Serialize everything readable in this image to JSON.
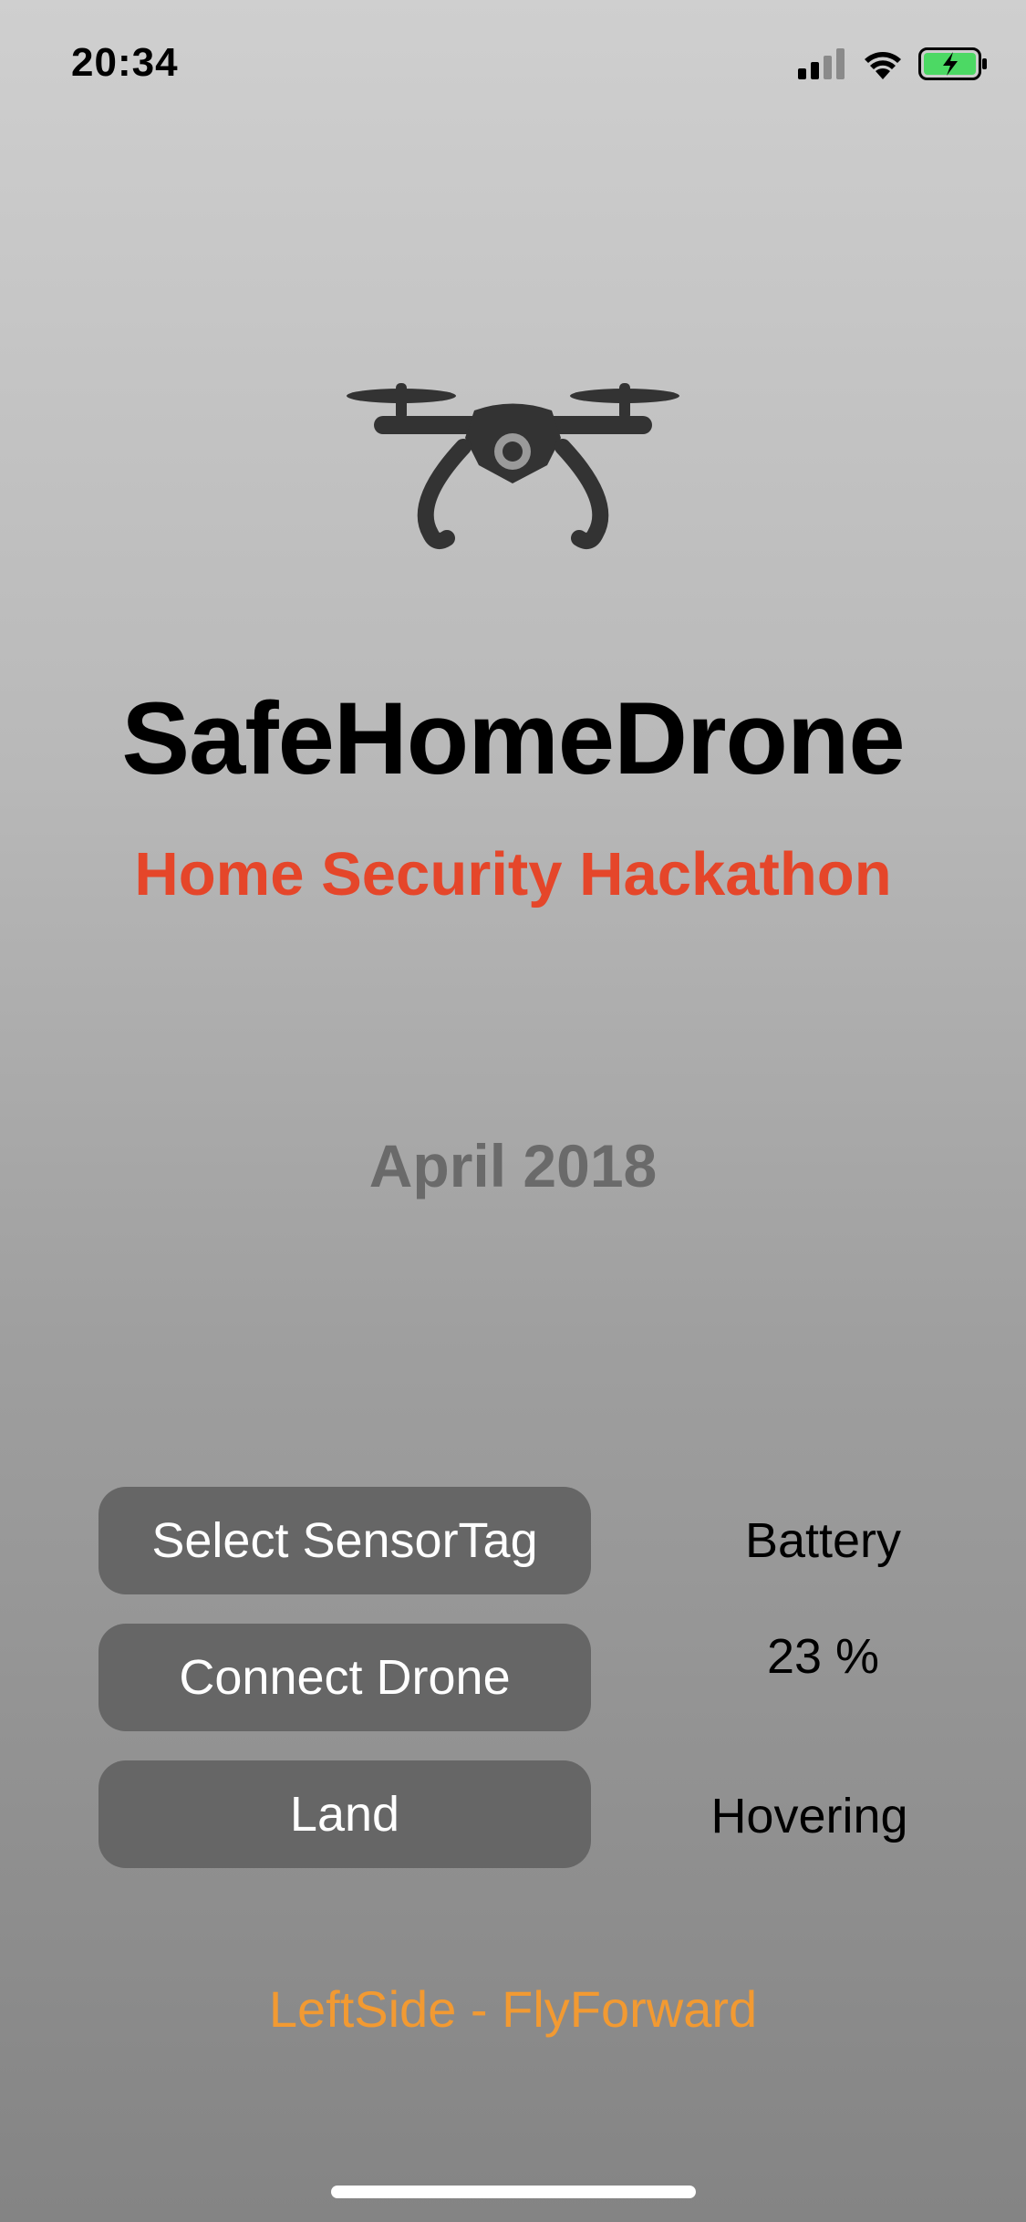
{
  "status_bar": {
    "time": "20:34",
    "icons": [
      "cellular-signal-icon",
      "wifi-icon",
      "battery-charging-icon"
    ]
  },
  "logo": {
    "icon": "drone-icon"
  },
  "header": {
    "title": "SafeHomeDrone",
    "subtitle": "Home Security Hackathon",
    "date": "April 2018"
  },
  "controls": {
    "select_sensortag_label": "Select SensorTag",
    "connect_drone_label": "Connect Drone",
    "land_label": "Land"
  },
  "status": {
    "battery_label": "Battery",
    "battery_value": "23 %",
    "flight_state": "Hovering"
  },
  "command": {
    "text": "LeftSide - FlyForward"
  },
  "colors": {
    "title": "#000000",
    "subtitle": "#e5462a",
    "date": "#6a6a6a",
    "button_bg": "#666666",
    "button_text": "#ffffff",
    "command_text": "#f29a32",
    "battery_fill": "#4cd964"
  }
}
